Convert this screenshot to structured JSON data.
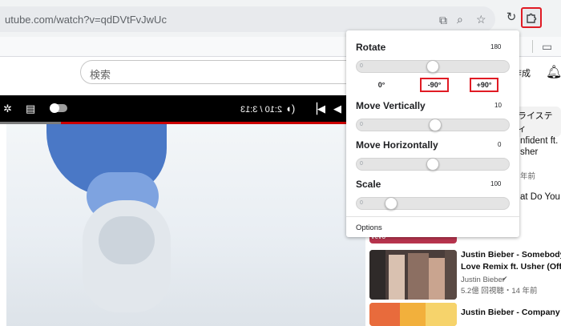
{
  "browser": {
    "url": "utube.com/watch?v=qdDVtFvJwUc",
    "reload_icon": "reload-icon",
    "extension_icon": "puzzle-extension-icon",
    "cast_icon": "cast-icon",
    "zoom_icon": "zoom-icon",
    "star_icon": "star-icon",
    "folder_icon": "folder-icon"
  },
  "youtube": {
    "search_placeholder": "検索",
    "create_label": "作成",
    "bell_icon": "bell-icon",
    "chip_label": "ライスティ"
  },
  "player": {
    "time": "2:10 / 3:13",
    "progress_fraction": 0.17
  },
  "popup": {
    "rotate": {
      "label": "Rotate",
      "value": "180",
      "min": "0",
      "fraction": 0.5
    },
    "rotate_buttons": [
      "0°",
      "-90°",
      "+90°"
    ],
    "move_vertically": {
      "label": "Move Vertically",
      "value": "10",
      "min": "0",
      "fraction": 0.52
    },
    "move_horizontally": {
      "label": "Move Horizontally",
      "value": "0",
      "min": "0",
      "fraction": 0.5
    },
    "scale": {
      "label": "Scale",
      "value": "100",
      "min": "0",
      "fraction": 0.2
    },
    "options_label": "Options"
  },
  "sidebar": {
    "items": [
      {
        "title_lines": [
          "nfident ft.",
          "sher"
        ],
        "meta": "年前"
      },
      {
        "title_lines": [
          "at Do You"
        ],
        "meta": ""
      },
      {
        "title_lines": [
          "Justin Bieber - Somebody To",
          "Love Remix ft. Usher (Official"
        ],
        "channel": "Justin Bieber",
        "meta": "5.2億 回視聴・14 年前"
      },
      {
        "title_lines": [
          "Justin Bieber - Company"
        ],
        "meta": ""
      }
    ],
    "vevo_label": "vevo"
  },
  "colors": {
    "highlight_red": "#e01b24",
    "youtube_red": "#cc0000"
  }
}
